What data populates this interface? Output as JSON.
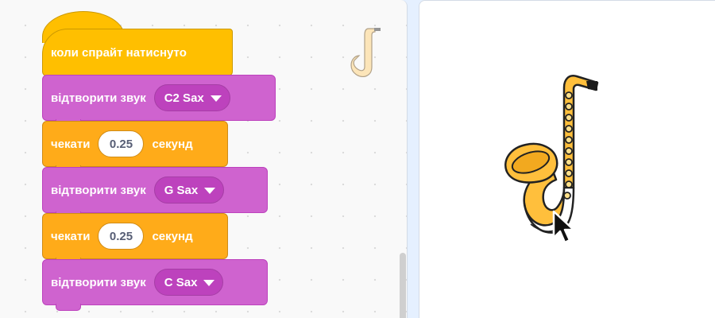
{
  "code_area": {
    "script": {
      "hat_block": {
        "label": "коли спрайт натиснуто"
      },
      "blocks": [
        {
          "label": "відтворити звук",
          "sound": "C2 Sax"
        },
        {
          "label": "чекати",
          "value": "0.25",
          "suffix": "секунд"
        },
        {
          "label": "відтворити звук",
          "sound": "G Sax"
        },
        {
          "label": "чекати",
          "value": "0.25",
          "suffix": "секунд"
        },
        {
          "label": "відтворити звук",
          "sound": "C Sax"
        }
      ]
    },
    "sprite_thumbnail": "saxophone-icon"
  },
  "stage": {
    "sprite": "saxophone-sprite",
    "cursor": "arrow-cursor-icon"
  },
  "colors": {
    "events": "#ffbf00",
    "control": "#ffab19",
    "sound": "#cf63cf",
    "sound_dropdown": "#bd42bd",
    "input_text": "#575e75",
    "saxophone": "#ffbf3c"
  }
}
